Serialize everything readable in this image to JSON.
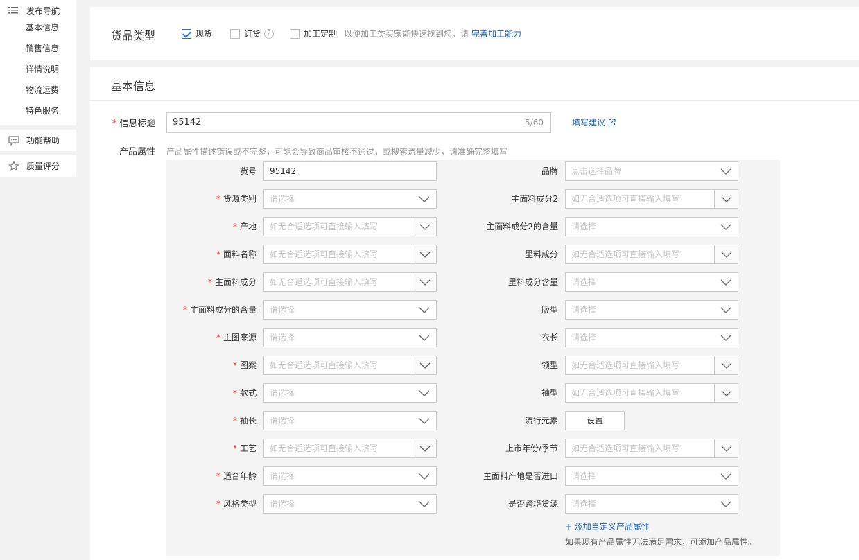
{
  "sidebar": {
    "nav_title": "发布导航",
    "nav_items": [
      "基本信息",
      "销售信息",
      "详情说明",
      "物流运费",
      "特色服务"
    ],
    "help": "功能帮助",
    "quality": "质量评分"
  },
  "goods_type": {
    "label": "货品类型",
    "options": [
      {
        "label": "现货",
        "checked": true
      },
      {
        "label": "订货",
        "checked": false
      },
      {
        "label": "加工定制",
        "checked": false
      }
    ],
    "question_mark": "?",
    "hint": "以便加工类买家能快速找到您，请",
    "hint_link": "完善加工能力"
  },
  "basic": {
    "title": "基本信息",
    "info_title_label": "信息标题",
    "info_title_value": "95142",
    "info_title_count": "5/60",
    "write_tip": "填写建议",
    "attr_label": "产品属性",
    "attr_hint": "产品属性描述错误或不完整，可能会导致商品审核不通过，或搜索流量减少，请准确完整填写",
    "req_mark": "*",
    "left_fields": [
      {
        "label": "货号",
        "required": false,
        "kind": "text",
        "value": "95142"
      },
      {
        "label": "货源类别",
        "required": true,
        "kind": "select",
        "placeholder": "请选择"
      },
      {
        "label": "产地",
        "required": true,
        "kind": "combo",
        "placeholder": "如无合适选项可直接输入填写"
      },
      {
        "label": "面料名称",
        "required": true,
        "kind": "combo",
        "placeholder": "如无合适选项可直接输入填写"
      },
      {
        "label": "主面料成分",
        "required": true,
        "kind": "combo",
        "placeholder": "如无合适选项可直接输入填写"
      },
      {
        "label": "主面料成分的含量",
        "required": true,
        "kind": "select",
        "placeholder": "请选择"
      },
      {
        "label": "主图来源",
        "required": true,
        "kind": "select",
        "placeholder": "请选择"
      },
      {
        "label": "图案",
        "required": true,
        "kind": "combo",
        "placeholder": "如无合适选项可直接输入填写"
      },
      {
        "label": "款式",
        "required": true,
        "kind": "select",
        "placeholder": "请选择"
      },
      {
        "label": "袖长",
        "required": true,
        "kind": "select",
        "placeholder": "请选择"
      },
      {
        "label": "工艺",
        "required": true,
        "kind": "combo",
        "placeholder": "如无合适选项可直接输入填写"
      },
      {
        "label": "适合年龄",
        "required": true,
        "kind": "select",
        "placeholder": "请选择"
      },
      {
        "label": "风格类型",
        "required": true,
        "kind": "select",
        "placeholder": "请选择"
      }
    ],
    "right_fields": [
      {
        "label": "品牌",
        "kind": "select",
        "placeholder": "点击选择品牌"
      },
      {
        "label": "主面料成分2",
        "kind": "combo",
        "placeholder": "如无合适选项可直接输入填写"
      },
      {
        "label": "主面料成分2的含量",
        "kind": "select",
        "placeholder": "请选择"
      },
      {
        "label": "里料成分",
        "kind": "combo",
        "placeholder": "如无合适选项可直接输入填写"
      },
      {
        "label": "里料成分含量",
        "kind": "select",
        "placeholder": "请选择"
      },
      {
        "label": "版型",
        "kind": "select",
        "placeholder": "请选择"
      },
      {
        "label": "衣长",
        "kind": "select",
        "placeholder": "请选择"
      },
      {
        "label": "领型",
        "kind": "combo",
        "placeholder": "如无合适选项可直接输入填写"
      },
      {
        "label": "袖型",
        "kind": "combo",
        "placeholder": "如无合适选项可直接输入填写"
      },
      {
        "label": "流行元素",
        "kind": "button",
        "button_label": "设置"
      },
      {
        "label": "上市年份/季节",
        "kind": "combo",
        "placeholder": "如无合适选项可直接输入填写"
      },
      {
        "label": "主面料产地是否进口",
        "kind": "select",
        "placeholder": "请选择"
      },
      {
        "label": "是否跨境货源",
        "kind": "select",
        "placeholder": "请选择"
      }
    ],
    "add_custom": "+ 添加自定义产品属性",
    "add_custom_note": "如果现有产品属性无法满足需求，可添加产品属性。"
  }
}
